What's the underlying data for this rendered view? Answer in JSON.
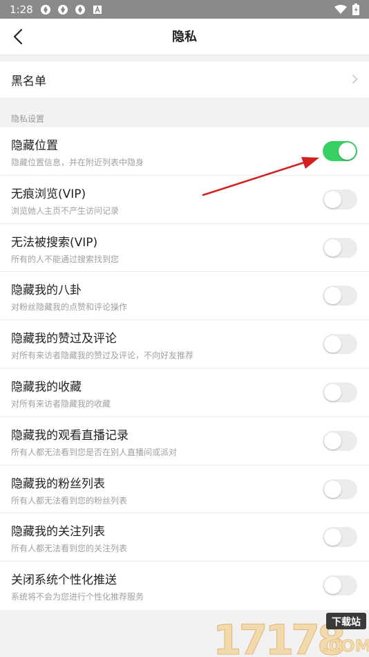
{
  "status_bar": {
    "time": "1:28",
    "icons": [
      "app-notification-icon",
      "app-notification-icon",
      "app-notification-icon",
      "a-letter-icon"
    ],
    "right_icons": [
      "wifi-icon",
      "battery-charging-icon"
    ]
  },
  "nav": {
    "title": "隐私",
    "back_icon": "back-arrow-icon"
  },
  "blacklist": {
    "label": "黑名单"
  },
  "section": {
    "title": "隐私设置"
  },
  "settings": [
    {
      "title": "隐藏位置",
      "desc": "隐藏位置信息，并在附近列表中隐身",
      "on": true
    },
    {
      "title": "无痕浏览(VIP)",
      "desc": "浏览她人主页不产生访问记录",
      "on": false
    },
    {
      "title": "无法被搜索(VIP)",
      "desc": "所有的人不能通过搜索找到您",
      "on": false
    },
    {
      "title": "隐藏我的八卦",
      "desc": "对粉丝隐藏我的点赞和评论操作",
      "on": false
    },
    {
      "title": "隐藏我的赞过及评论",
      "desc": "对所有来访者隐藏我的赞过及评论，不向好友推荐",
      "on": false
    },
    {
      "title": "隐藏我的收藏",
      "desc": "对所有来访者隐藏我的收藏",
      "on": false
    },
    {
      "title": "隐藏我的观看直播记录",
      "desc": "所有人都无法看到您是否在别人直播间或派对",
      "on": false
    },
    {
      "title": "隐藏我的粉丝列表",
      "desc": "所有人都无法看到您的粉丝列表",
      "on": false
    },
    {
      "title": "隐藏我的关注列表",
      "desc": "所有人都无法看到您的关注列表",
      "on": false
    },
    {
      "title": "关闭系统个性化推送",
      "desc": "系统将不会为您进行个性化推荐服务",
      "on": false
    }
  ],
  "watermark": {
    "number": "17178",
    "domain": ".COM",
    "badge": "下载站"
  },
  "colors": {
    "toggle_on": "#38cf63",
    "toggle_off": "#ececec",
    "annotation_arrow": "#d42020"
  }
}
